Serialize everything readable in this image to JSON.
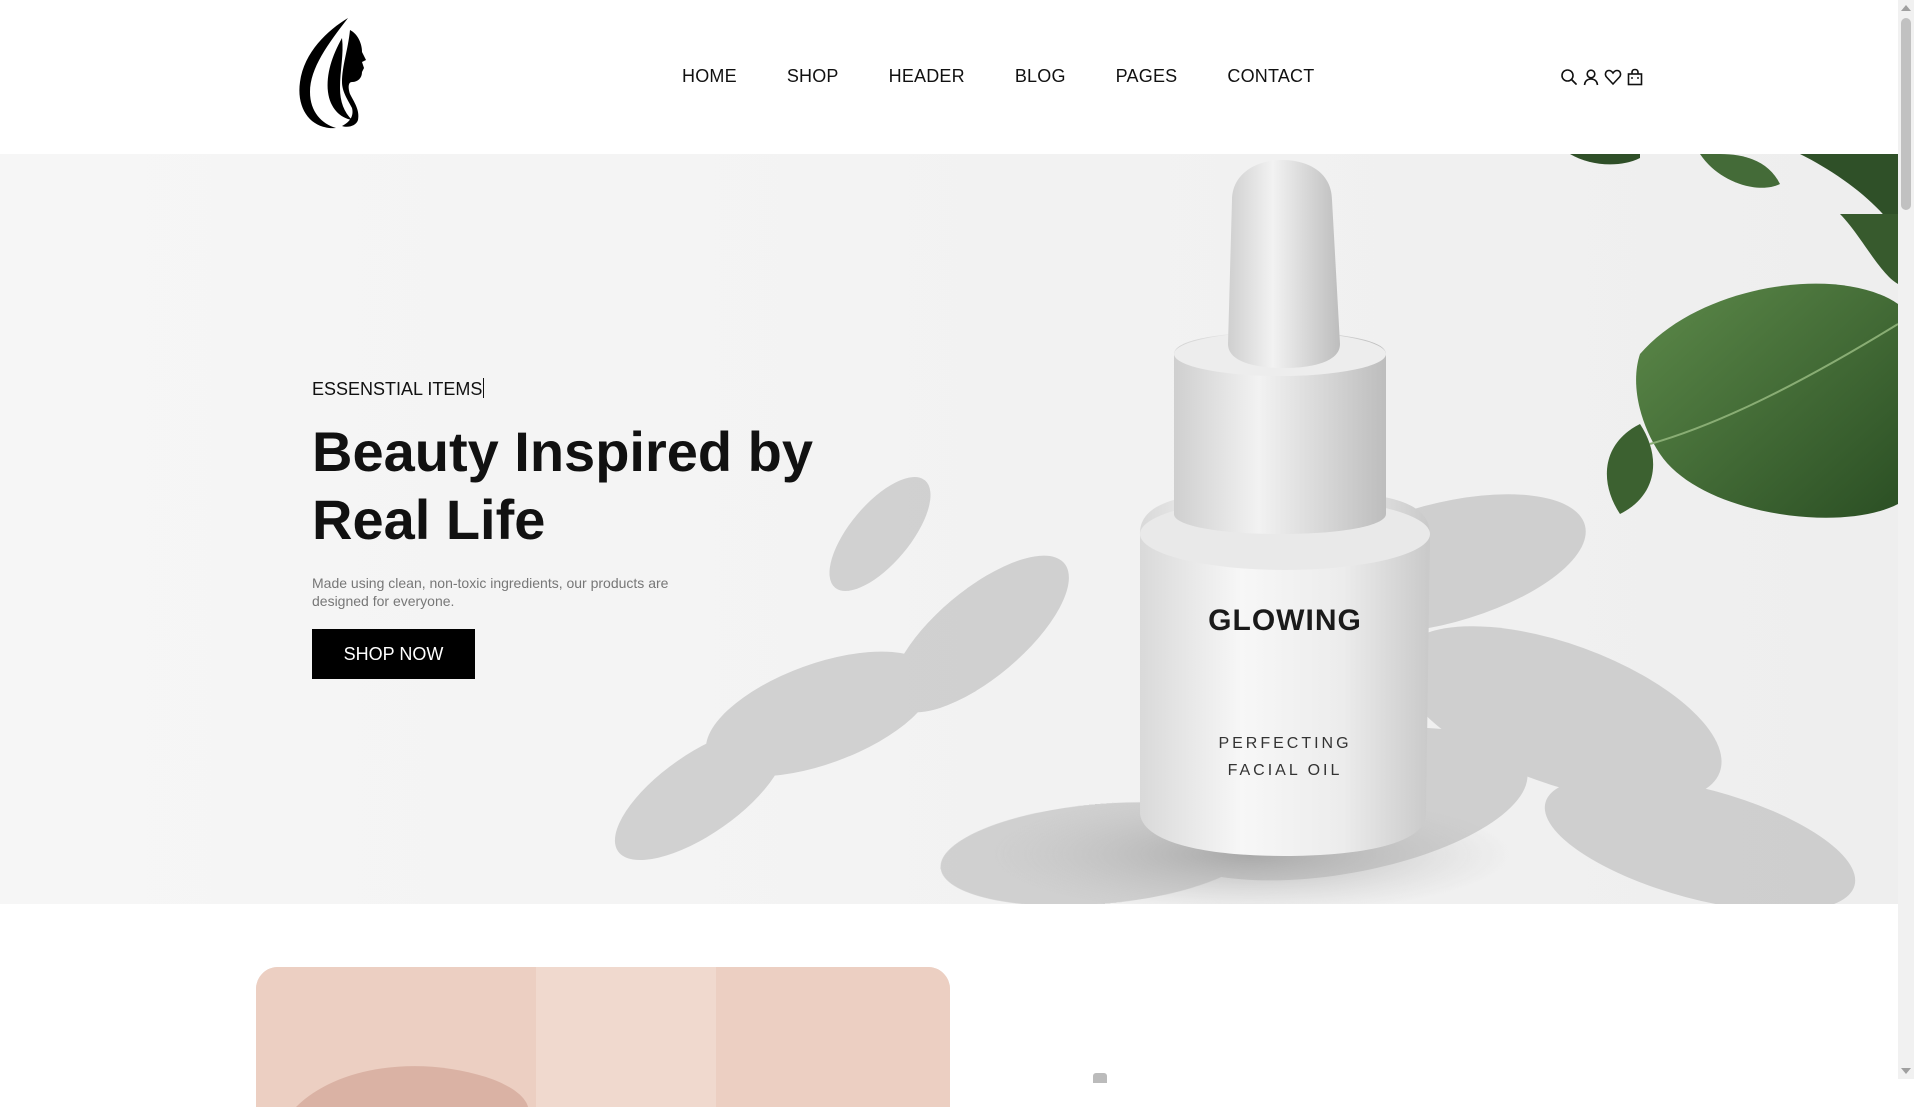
{
  "nav": {
    "items": [
      {
        "label": "HOME"
      },
      {
        "label": "SHOP"
      },
      {
        "label": "HEADER"
      },
      {
        "label": "BLOG"
      },
      {
        "label": "PAGES"
      },
      {
        "label": "CONTACT"
      }
    ]
  },
  "header_icons": [
    "search-icon",
    "user-icon",
    "heart-icon",
    "bag-icon"
  ],
  "hero": {
    "eyebrow": "ESSENSTIAL ITEMS",
    "title": "Beauty Inspired by Real Life",
    "description": "Made using clean, non-toxic ingredients, our products are designed for everyone.",
    "cta_label": "SHOP NOW",
    "product_brand": "GLOWING",
    "product_line1": "PERFECTING",
    "product_line2": "FACIAL OIL"
  },
  "colors": {
    "accent": "#000000",
    "hero_bg": "#f3f3f3",
    "leaf_green": "#3f6b34",
    "lower_image_tint": "#e8cfc3"
  }
}
